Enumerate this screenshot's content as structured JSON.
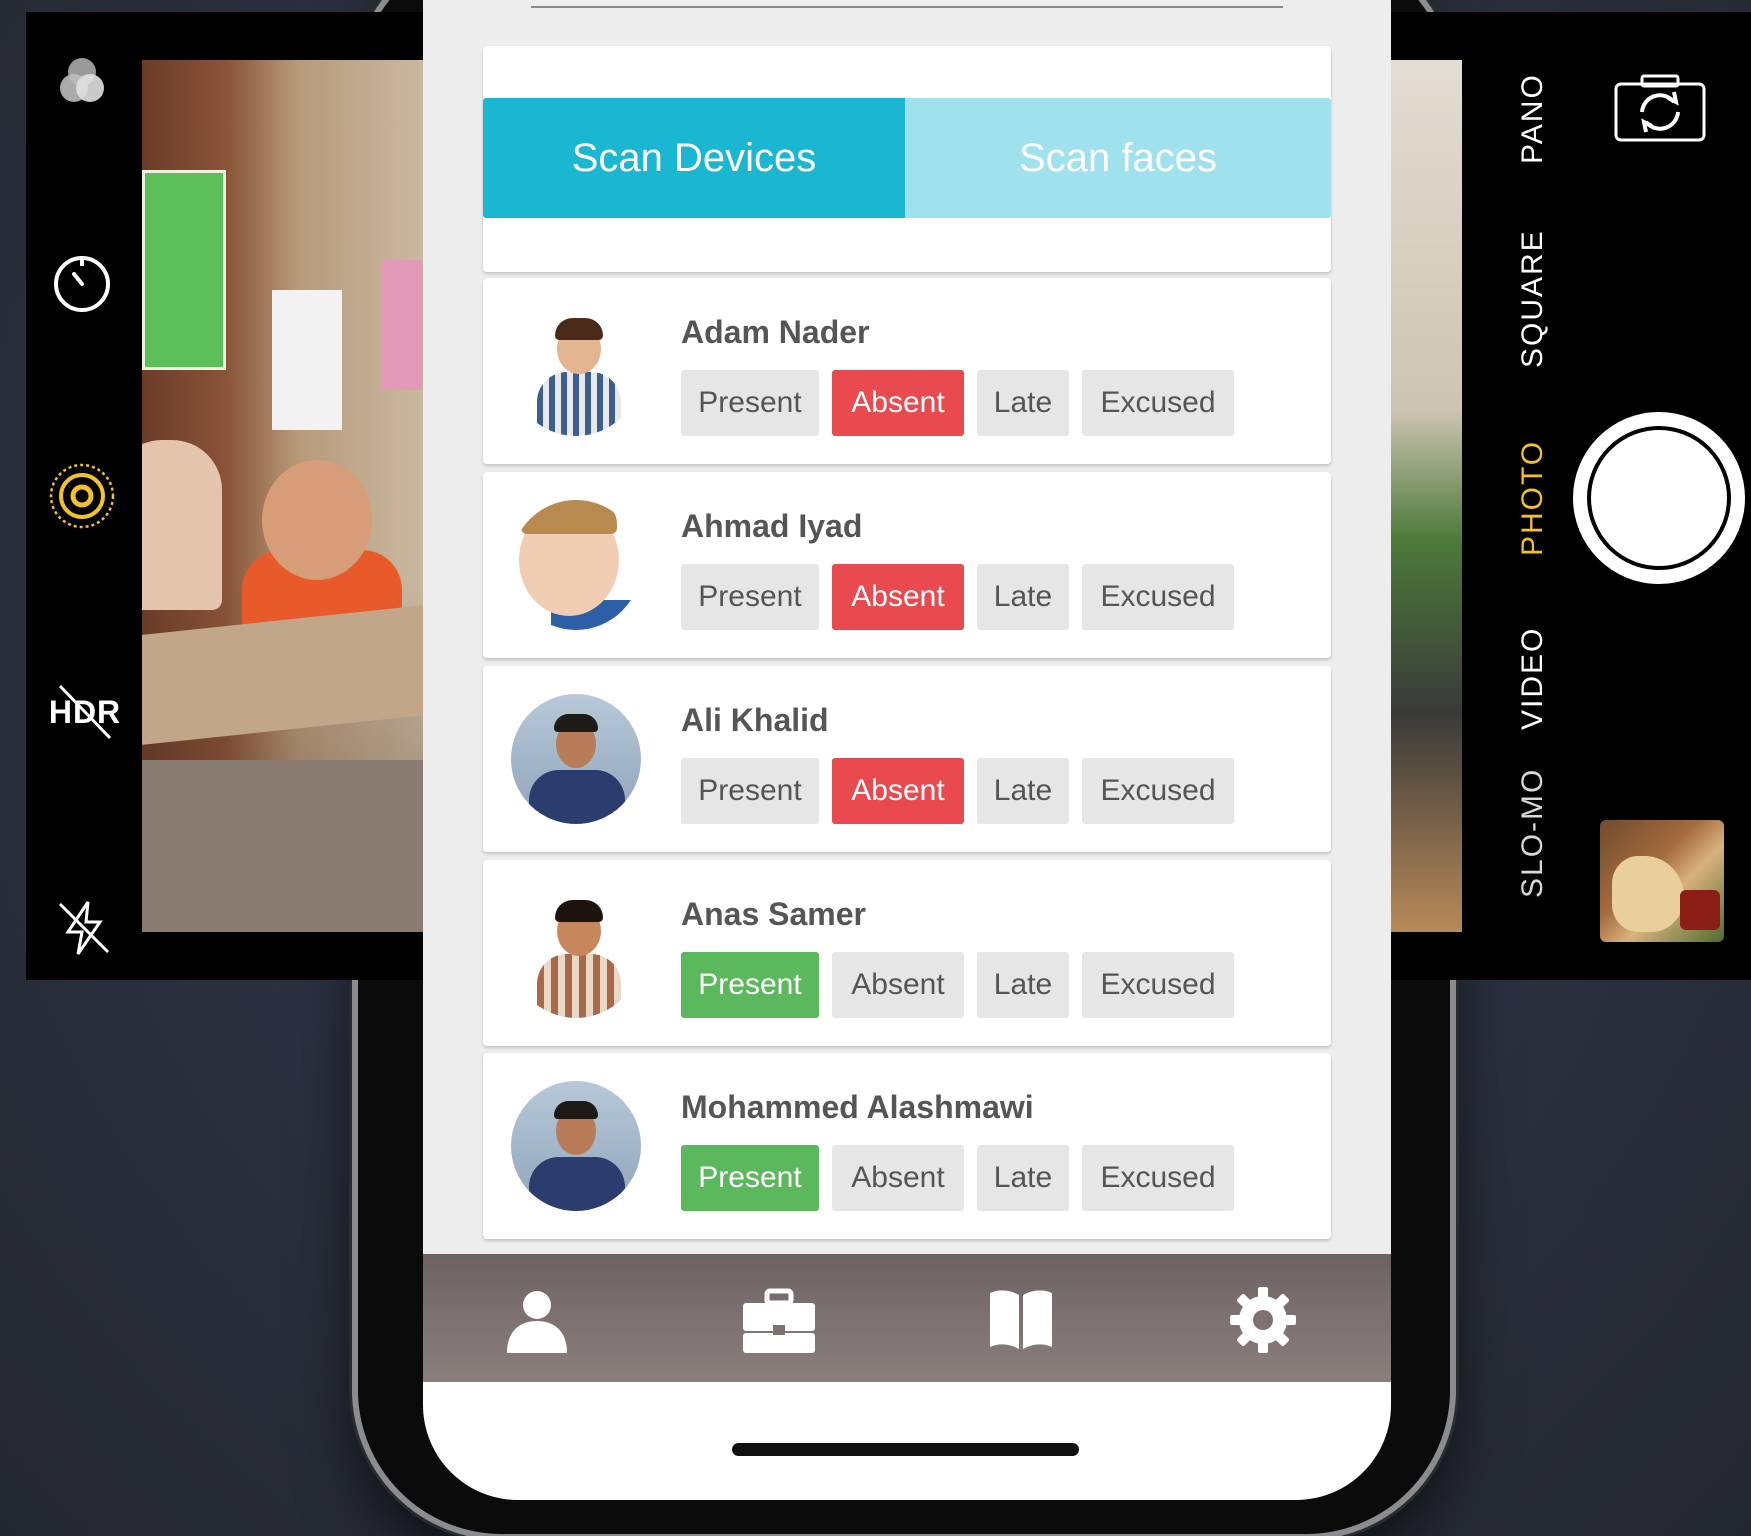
{
  "camera": {
    "modes": [
      "PANO",
      "SQUARE",
      "PHOTO",
      "VIDEO",
      "SLO-MO"
    ],
    "active_mode": "PHOTO",
    "hdr_label": "HDR",
    "accent_color": "#f2c22d",
    "icons": [
      "filters-icon",
      "timer-icon",
      "live-photo-icon",
      "hdr-off-icon",
      "flash-off-icon",
      "switch-camera-icon"
    ]
  },
  "app": {
    "scan": {
      "devices_label": "Scan Devices",
      "faces_label": "Scan faces",
      "active": "devices",
      "active_color": "#1ab6d2",
      "inactive_color": "#9fe1ec"
    },
    "attendance_labels": {
      "present": "Present",
      "absent": "Absent",
      "late": "Late",
      "excused": "Excused"
    },
    "status_colors": {
      "absent": "#e84a4f",
      "present": "#5cb85c"
    },
    "students": [
      {
        "name": "Adam Nader",
        "status": "absent"
      },
      {
        "name": "Ahmad Iyad",
        "status": "absent"
      },
      {
        "name": "Ali Khalid",
        "status": "absent"
      },
      {
        "name": "Anas Samer",
        "status": "present"
      },
      {
        "name": "Mohammed Alashmawi",
        "status": "present"
      }
    ],
    "tabs": [
      "profile-icon",
      "briefcase-icon",
      "book-icon",
      "settings-icon"
    ]
  }
}
